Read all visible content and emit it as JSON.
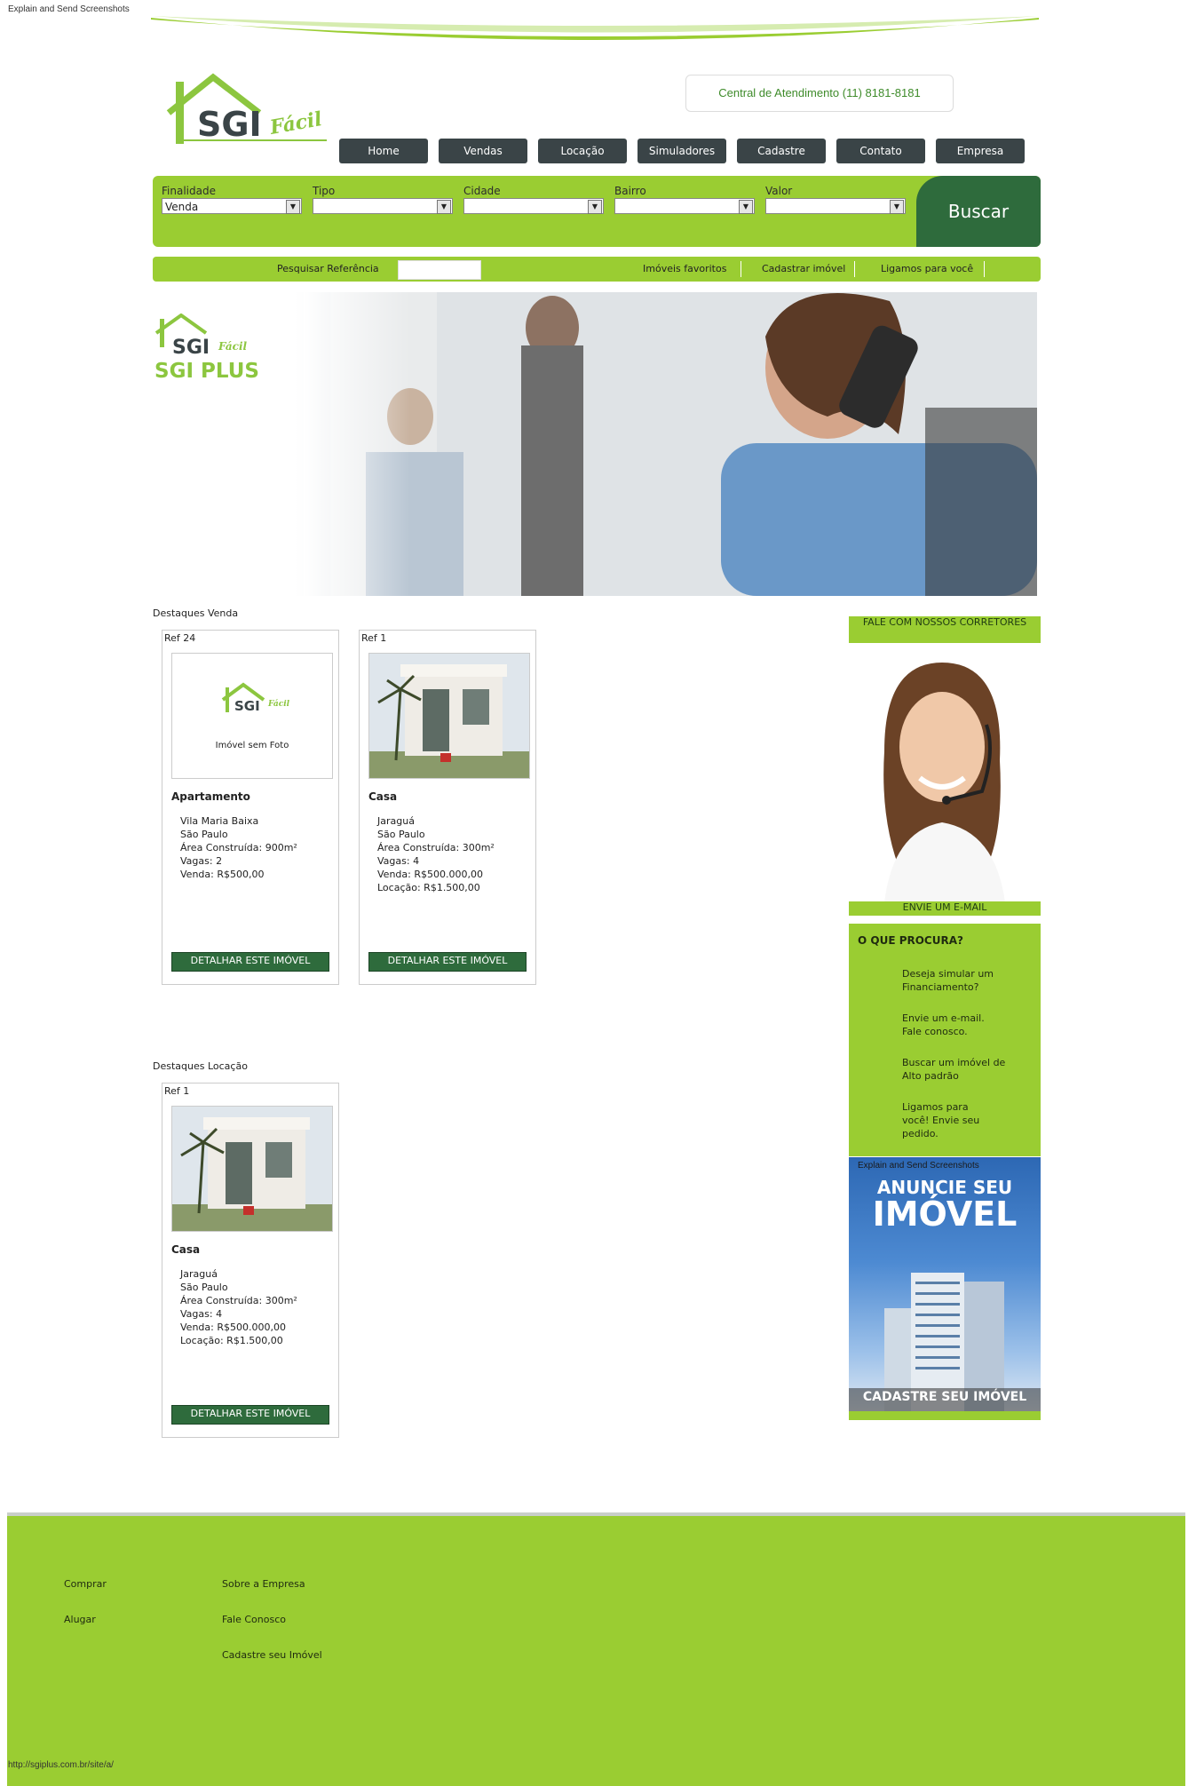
{
  "browser": {
    "top_caption": "Explain and Send Screenshots",
    "status_url": "http://sgiplus.com.br/site/a/"
  },
  "header": {
    "logo_brand": "SGI",
    "logo_script": "Fácil",
    "phone": "Central de Atendimento (11) 8181-8181",
    "nav": [
      "Home",
      "Vendas",
      "Locação",
      "Simuladores",
      "Cadastre",
      "Contato",
      "Empresa"
    ]
  },
  "search": {
    "fields": [
      {
        "label": "Finalidade",
        "value": "Venda"
      },
      {
        "label": "Tipo",
        "value": ""
      },
      {
        "label": "Cidade",
        "value": ""
      },
      {
        "label": "Bairro",
        "value": ""
      },
      {
        "label": "Valor",
        "value": ""
      }
    ],
    "button": "Buscar"
  },
  "subbar": {
    "ref_label": "Pesquisar Referência",
    "ref_value": "",
    "links": [
      "Imóveis favoritos",
      "Cadastrar imóvel",
      "Ligamos para você"
    ]
  },
  "banner": {
    "brand": "SGI",
    "script": "Fácil",
    "subtitle": "SGI PLUS"
  },
  "destaques_venda": {
    "title": "Destaques Venda",
    "cards": [
      {
        "ref": "Ref 24",
        "no_photo_text": "Imóvel sem Foto",
        "type": "Apartamento",
        "lines": [
          "Vila Maria Baixa",
          "São Paulo",
          "Área Construída: 900m²",
          "Vagas: 2",
          "Venda: R$500,00"
        ],
        "button": "DETALHAR ESTE IMÓVEL"
      },
      {
        "ref": "Ref 1",
        "type": "Casa",
        "lines": [
          "Jaraguá",
          "São Paulo",
          "Área Construída: 300m²",
          "Vagas: 4",
          "Venda: R$500.000,00",
          "Locação: R$1.500,00"
        ],
        "button": "DETALHAR ESTE IMÓVEL"
      }
    ]
  },
  "destaques_locacao": {
    "title": "Destaques Locação",
    "cards": [
      {
        "ref": "Ref 1",
        "type": "Casa",
        "lines": [
          "Jaraguá",
          "São Paulo",
          "Área Construída: 300m²",
          "Vagas: 4",
          "Venda: R$500.000,00",
          "Locação: R$1.500,00"
        ],
        "button": "DETALHAR ESTE IMÓVEL"
      }
    ]
  },
  "sidebar": {
    "fale_title": "FALE COM NOSSOS CORRETORES",
    "envie": "ENVIE UM E-MAIL",
    "procura_title": "O QUE PROCURA?",
    "procura_links": [
      "Deseja simular um Financiamento?",
      "Envie um e-mail. Fale conosco.",
      "Buscar um imóvel de Alto padrão",
      "Ligamos para você! Envie seu pedido."
    ],
    "anuncie_caption": "Explain and Send Screenshots",
    "anuncie_line1": "ANUNCIE SEU",
    "anuncie_line2": "IMÓVEL",
    "anuncie_cta": "CADASTRE SEU IMÓVEL"
  },
  "footer": {
    "col1": [
      "Comprar",
      "Alugar"
    ],
    "col2": [
      "Sobre a Empresa",
      "Fale Conosco",
      "Cadastre seu Imóvel"
    ]
  },
  "colors": {
    "accent_green": "#9acd32",
    "dark_green": "#2e6b3c",
    "nav_dark": "#3a4447"
  }
}
